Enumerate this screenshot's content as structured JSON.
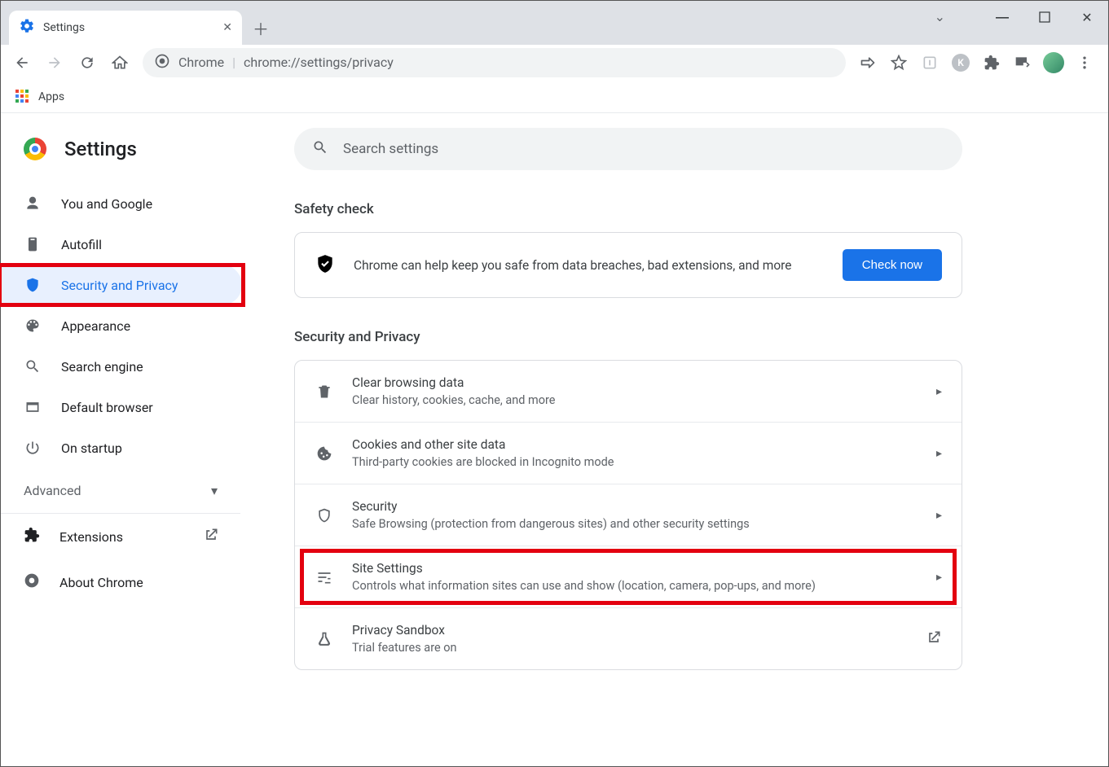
{
  "window": {
    "tab_title": "Settings",
    "new_tab_tooltip": "New tab"
  },
  "omnibox": {
    "scheme_label": "Chrome",
    "url_path": "chrome://settings/privacy"
  },
  "bookmarks": {
    "apps_label": "Apps"
  },
  "brand": {
    "title": "Settings"
  },
  "sidebar": {
    "items": [
      {
        "label": "You and Google"
      },
      {
        "label": "Autofill"
      },
      {
        "label": "Security and Privacy"
      },
      {
        "label": "Appearance"
      },
      {
        "label": "Search engine"
      },
      {
        "label": "Default browser"
      },
      {
        "label": "On startup"
      }
    ],
    "advanced_label": "Advanced",
    "extensions_label": "Extensions",
    "about_label": "About Chrome"
  },
  "search": {
    "placeholder": "Search settings"
  },
  "sections": {
    "safety_title": "Safety check",
    "safety_text": "Chrome can help keep you safe from data breaches, bad extensions, and more",
    "check_now": "Check now",
    "privacy_title": "Security and Privacy",
    "rows": [
      {
        "title": "Clear browsing data",
        "sub": "Clear history, cookies, cache, and more"
      },
      {
        "title": "Cookies and other site data",
        "sub": "Third-party cookies are blocked in Incognito mode"
      },
      {
        "title": "Security",
        "sub": "Safe Browsing (protection from dangerous sites) and other security settings"
      },
      {
        "title": "Site Settings",
        "sub": "Controls what information sites can use and show (location, camera, pop-ups, and more)"
      },
      {
        "title": "Privacy Sandbox",
        "sub": "Trial features are on"
      }
    ]
  }
}
